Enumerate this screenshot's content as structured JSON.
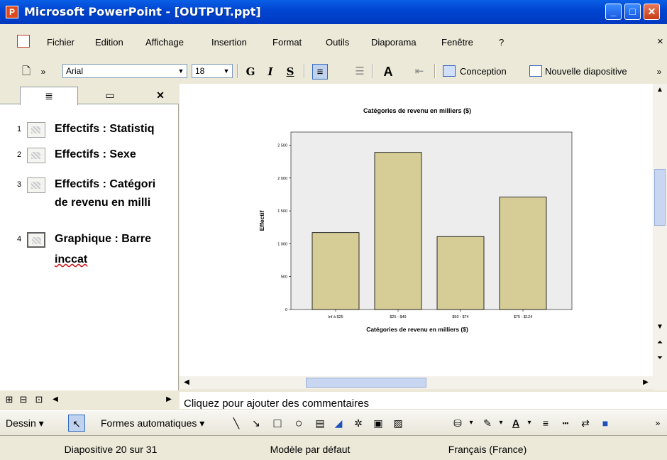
{
  "window": {
    "title": "Microsoft PowerPoint - [OUTPUT.ppt]"
  },
  "menu": {
    "items": [
      "Fichier",
      "Edition",
      "Affichage",
      "Insertion",
      "Format",
      "Outils",
      "Diaporama",
      "Fenêtre",
      "?"
    ],
    "close_glyph": "×"
  },
  "toolbar": {
    "font": "Arial",
    "size": "18",
    "bold": "G",
    "italic": "I",
    "underline": "S",
    "design_label": "Conception",
    "new_slide_label": "Nouvelle diapositive"
  },
  "outline": {
    "items": [
      {
        "num": "1",
        "line1": "Effectifs : Statistiq",
        "line2": ""
      },
      {
        "num": "2",
        "line1": "Effectifs : Sexe",
        "line2": ""
      },
      {
        "num": "3",
        "line1": "Effectifs : Catégori",
        "line2": "de revenu en milli"
      },
      {
        "num": "4",
        "line1": "Graphique : Barre",
        "line2": "inccat"
      }
    ]
  },
  "chart_data": {
    "type": "bar",
    "title": "Catégories de revenu en milliers ($)",
    "xlabel": "Catégories de revenu en milliers ($)",
    "ylabel": "Effectif",
    "categories": [
      "Inf à $25",
      "$25 - $49",
      "$50 - $74",
      "$75 - $124"
    ],
    "values": [
      1170,
      2390,
      1110,
      1710
    ],
    "ylim": [
      0,
      2700
    ],
    "yticks": [
      "0",
      "500",
      "1 000",
      "1 500",
      "2 000",
      "2 500"
    ],
    "ytick_values": [
      0,
      500,
      1000,
      1500,
      2000,
      2500
    ],
    "bar_color": "#D5CC96",
    "plot_bg": "#EDEDED",
    "grid": false
  },
  "notes": {
    "placeholder": "Cliquez pour ajouter des commentaires"
  },
  "drawing": {
    "draw_label": "Dessin",
    "autoshapes_label": "Formes automatiques"
  },
  "status": {
    "slide": "Diapositive 20 sur 31",
    "template": "Modèle par défaut",
    "language": "Français (France)"
  }
}
